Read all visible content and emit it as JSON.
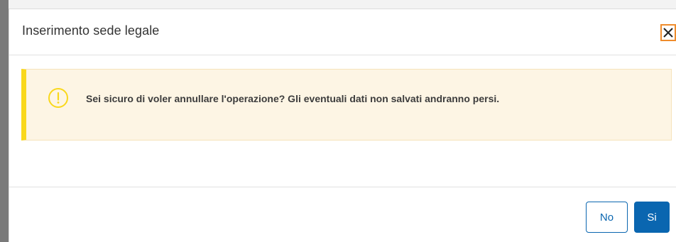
{
  "dialog": {
    "title": "Inserimento sede legale",
    "close_icon": "close-icon"
  },
  "alert": {
    "type": "warning",
    "icon": "warning-circle-icon",
    "message": "Sei sicuro di voler annullare l'operazione? Gli eventuali dati non salvati andranno persi."
  },
  "footer": {
    "no_label": "No",
    "si_label": "Si"
  },
  "colors": {
    "alert_accent": "#f9d81c",
    "alert_background": "#fdf5e4",
    "primary": "#0a66b0",
    "focus_outline": "#ef8c2c"
  }
}
